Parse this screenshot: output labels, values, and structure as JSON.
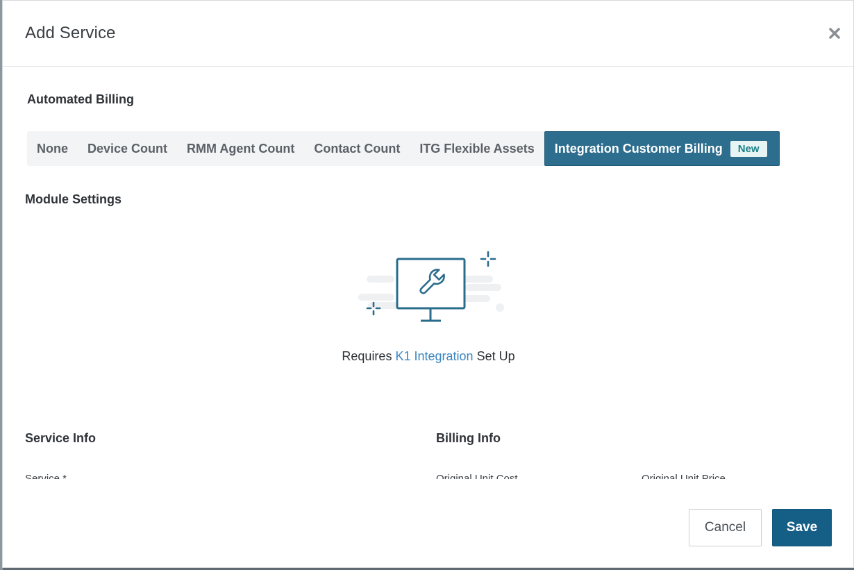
{
  "modal": {
    "title": "Add Service",
    "close_icon": "close-icon"
  },
  "automated_billing": {
    "heading": "Automated Billing",
    "tabs": [
      {
        "label": "None",
        "active": false
      },
      {
        "label": "Device Count",
        "active": false
      },
      {
        "label": "RMM Agent Count",
        "active": false
      },
      {
        "label": "Contact Count",
        "active": false
      },
      {
        "label": "ITG Flexible Assets",
        "active": false
      },
      {
        "label": "Integration Customer Billing",
        "active": true,
        "badge": "New"
      }
    ]
  },
  "module_settings": {
    "heading": "Module Settings",
    "illustration_icon": "monitor-wrench-icon",
    "requires_prefix": "Requires",
    "requires_link": "K1 Integration",
    "requires_suffix": "Set Up"
  },
  "service_info": {
    "heading": "Service Info",
    "service_label": "Service *"
  },
  "billing_info": {
    "heading": "Billing Info",
    "original_unit_cost_label": "Original Unit Cost",
    "original_unit_price_label": "Original Unit Price"
  },
  "footer": {
    "cancel_label": "Cancel",
    "save_label": "Save"
  },
  "colors": {
    "active_tab": "#2d6e8e",
    "primary_button": "#155f87",
    "link": "#3a86c0",
    "badge_bg": "#e6f5f4",
    "badge_text": "#1b7f86"
  }
}
